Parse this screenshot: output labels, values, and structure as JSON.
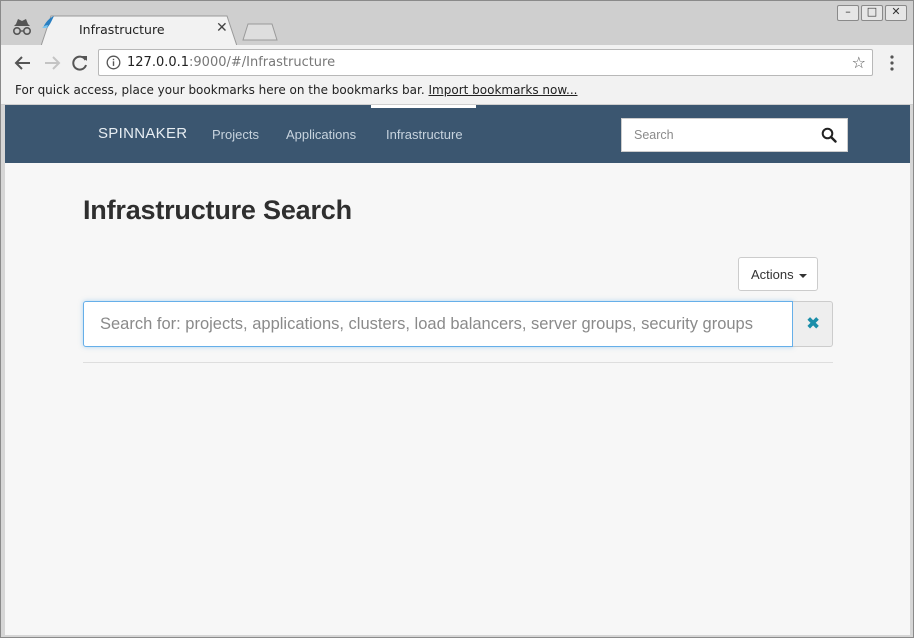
{
  "browser": {
    "tab": {
      "title": "Infrastructure"
    },
    "address": {
      "host": "127.0.0.1",
      "rest": ":9000/#/Infrastructure"
    },
    "bookmarks": {
      "prompt": "For quick access, place your bookmarks here on the bookmarks bar.",
      "link": "Import bookmarks now..."
    }
  },
  "app": {
    "brand": "SPINNAKER",
    "nav": {
      "projects": "Projects",
      "applications": "Applications",
      "infrastructure": "Infrastructure"
    },
    "nav_search": {
      "placeholder": "Search"
    },
    "title": "Infrastructure Search",
    "actions_label": "Actions",
    "search": {
      "placeholder": "Search for: projects, applications, clusters, load balancers, server groups, security groups"
    }
  },
  "colors": {
    "nav_bg": "#3b5670",
    "accent": "#1b8ea9",
    "focus_border": "#66afe9"
  }
}
